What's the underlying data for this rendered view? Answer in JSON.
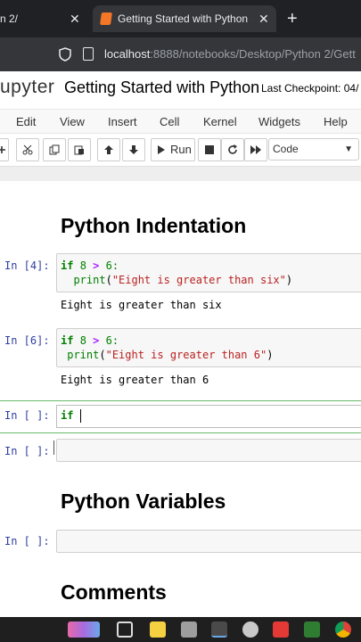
{
  "browser": {
    "tabs": [
      {
        "label": "n 2/",
        "close": "✕"
      },
      {
        "label": "Getting Started with Python - Ju",
        "close": "✕"
      }
    ],
    "new_tab": "+",
    "url_host": "localhost",
    "url_path": ":8888/notebooks/Desktop/Python 2/Gett"
  },
  "jupyter": {
    "logo": "upyter",
    "notebook_title": "Getting Started with Python",
    "checkpoint": "Last Checkpoint: 04/"
  },
  "menu": [
    "Edit",
    "View",
    "Insert",
    "Cell",
    "Kernel",
    "Widgets",
    "Help"
  ],
  "toolbar": {
    "run_label": "Run",
    "cell_type": "Code"
  },
  "cells": {
    "heading1": "Python Indentation",
    "c1": {
      "prompt": "In [4]:",
      "line1_kw": "if",
      "line1_a": "8",
      "line1_op": ">",
      "line1_b": "6:",
      "line2_fn": "print",
      "line2_str": "\"Eight is greater than six\"",
      "output": "Eight is greater than six"
    },
    "c2": {
      "prompt": "In [6]:",
      "line1_kw": "if",
      "line1_a": "8",
      "line1_op": ">",
      "line1_b": "6:",
      "line2_fn": "print",
      "line2_str": "\"Eight is greater than 6\"",
      "output": "Eight is greater than 6"
    },
    "c3": {
      "prompt": "In [ ]:",
      "code": "if "
    },
    "c4": {
      "prompt": "In [ ]:"
    },
    "heading2": "Python Variables",
    "c5": {
      "prompt": "In [ ]:"
    },
    "heading3": "Comments"
  },
  "colors": {
    "selected_cell_border": "#66bb6a",
    "prompt": "#303f9f",
    "keyword": "#008000",
    "string": "#ba2121",
    "operator": "#aa22ff"
  }
}
